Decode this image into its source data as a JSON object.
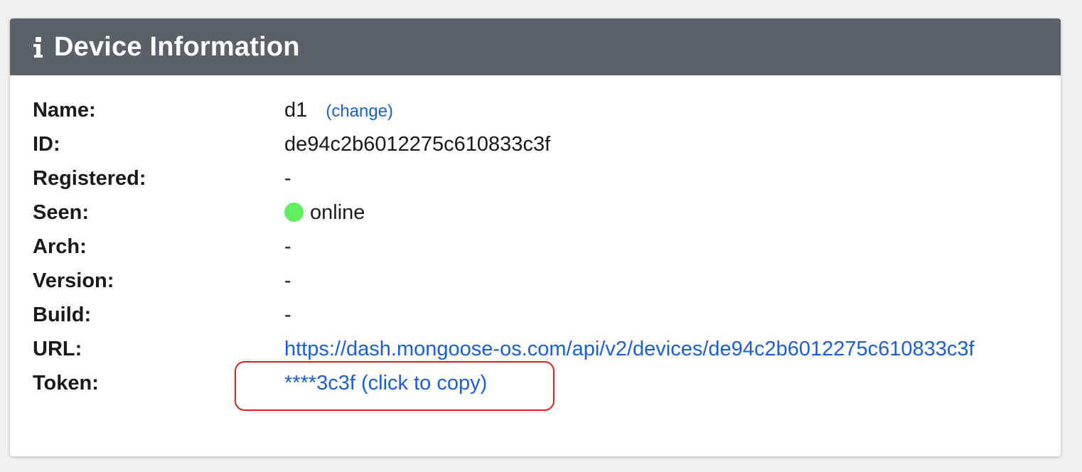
{
  "panel": {
    "title": "Device Information",
    "icon": "info-icon"
  },
  "fields": {
    "name": {
      "label": "Name:",
      "value": "d1",
      "action_label": "(change)"
    },
    "id": {
      "label": "ID:",
      "value": "de94c2b6012275c610833c3f"
    },
    "registered": {
      "label": "Registered:",
      "value": "-"
    },
    "seen": {
      "label": "Seen:",
      "value": "online",
      "status_color": "#5ef05e"
    },
    "arch": {
      "label": "Arch:",
      "value": "-"
    },
    "version": {
      "label": "Version:",
      "value": "-"
    },
    "build": {
      "label": "Build:",
      "value": "-"
    },
    "url": {
      "label": "URL:",
      "value": "https://dash.mongoose-os.com/api/v2/devices/de94c2b6012275c610833c3f"
    },
    "token": {
      "label": "Token:",
      "value": "****3c3f (click to copy)"
    }
  },
  "colors": {
    "header_bg": "#5a6169",
    "link": "#1a5fd9",
    "highlight": "#e21a1a"
  }
}
